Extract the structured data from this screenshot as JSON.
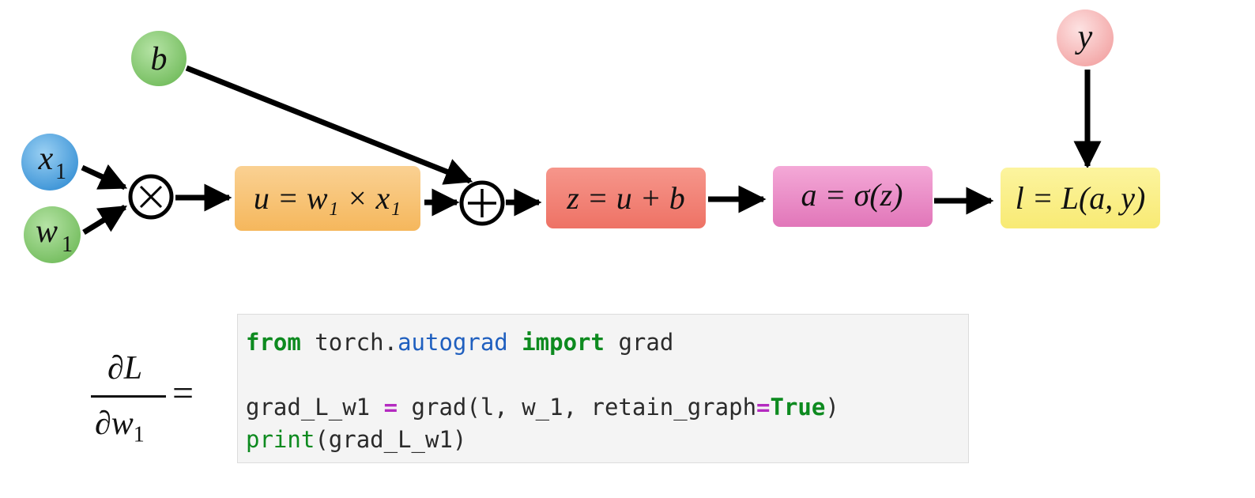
{
  "nodes": {
    "b": {
      "label": "b",
      "color": "#8fcf7b"
    },
    "x1": {
      "label": "x",
      "sub": "1",
      "color": "#5aaee6"
    },
    "w1": {
      "label": "w",
      "sub": "1",
      "color": "#8fcf7b"
    },
    "y": {
      "label": "y",
      "color": "#f7b5b5"
    }
  },
  "operators": {
    "multiply": {
      "symbol": "⊗"
    },
    "add": {
      "symbol": "⊕"
    }
  },
  "boxes": {
    "u": {
      "text": "u = w₁ × x₁",
      "color": "#f8c46e"
    },
    "z": {
      "text": "z = u + b",
      "color": "#f17f73"
    },
    "a": {
      "text": "a = σ(z)",
      "color": "#e885c4"
    },
    "l": {
      "text": "l = L(a, y)",
      "color": "#faf08a"
    }
  },
  "formula": {
    "numerator": "∂L",
    "denominator": "∂w",
    "denominator_sub": "1",
    "equals": "="
  },
  "code": {
    "line1": {
      "kw1": "from",
      "text1": " torch.",
      "module": "autograd",
      "text2": " ",
      "kw2": "import",
      "text3": " grad"
    },
    "line3": {
      "text1": "grad_L_w1 ",
      "op1": "=",
      "text2": " grad(l, w_1, retain_graph",
      "op2": "=",
      "kw": "True",
      "text3": ")"
    },
    "line4": {
      "builtin": "print",
      "text": "(grad_L_w1)"
    }
  }
}
